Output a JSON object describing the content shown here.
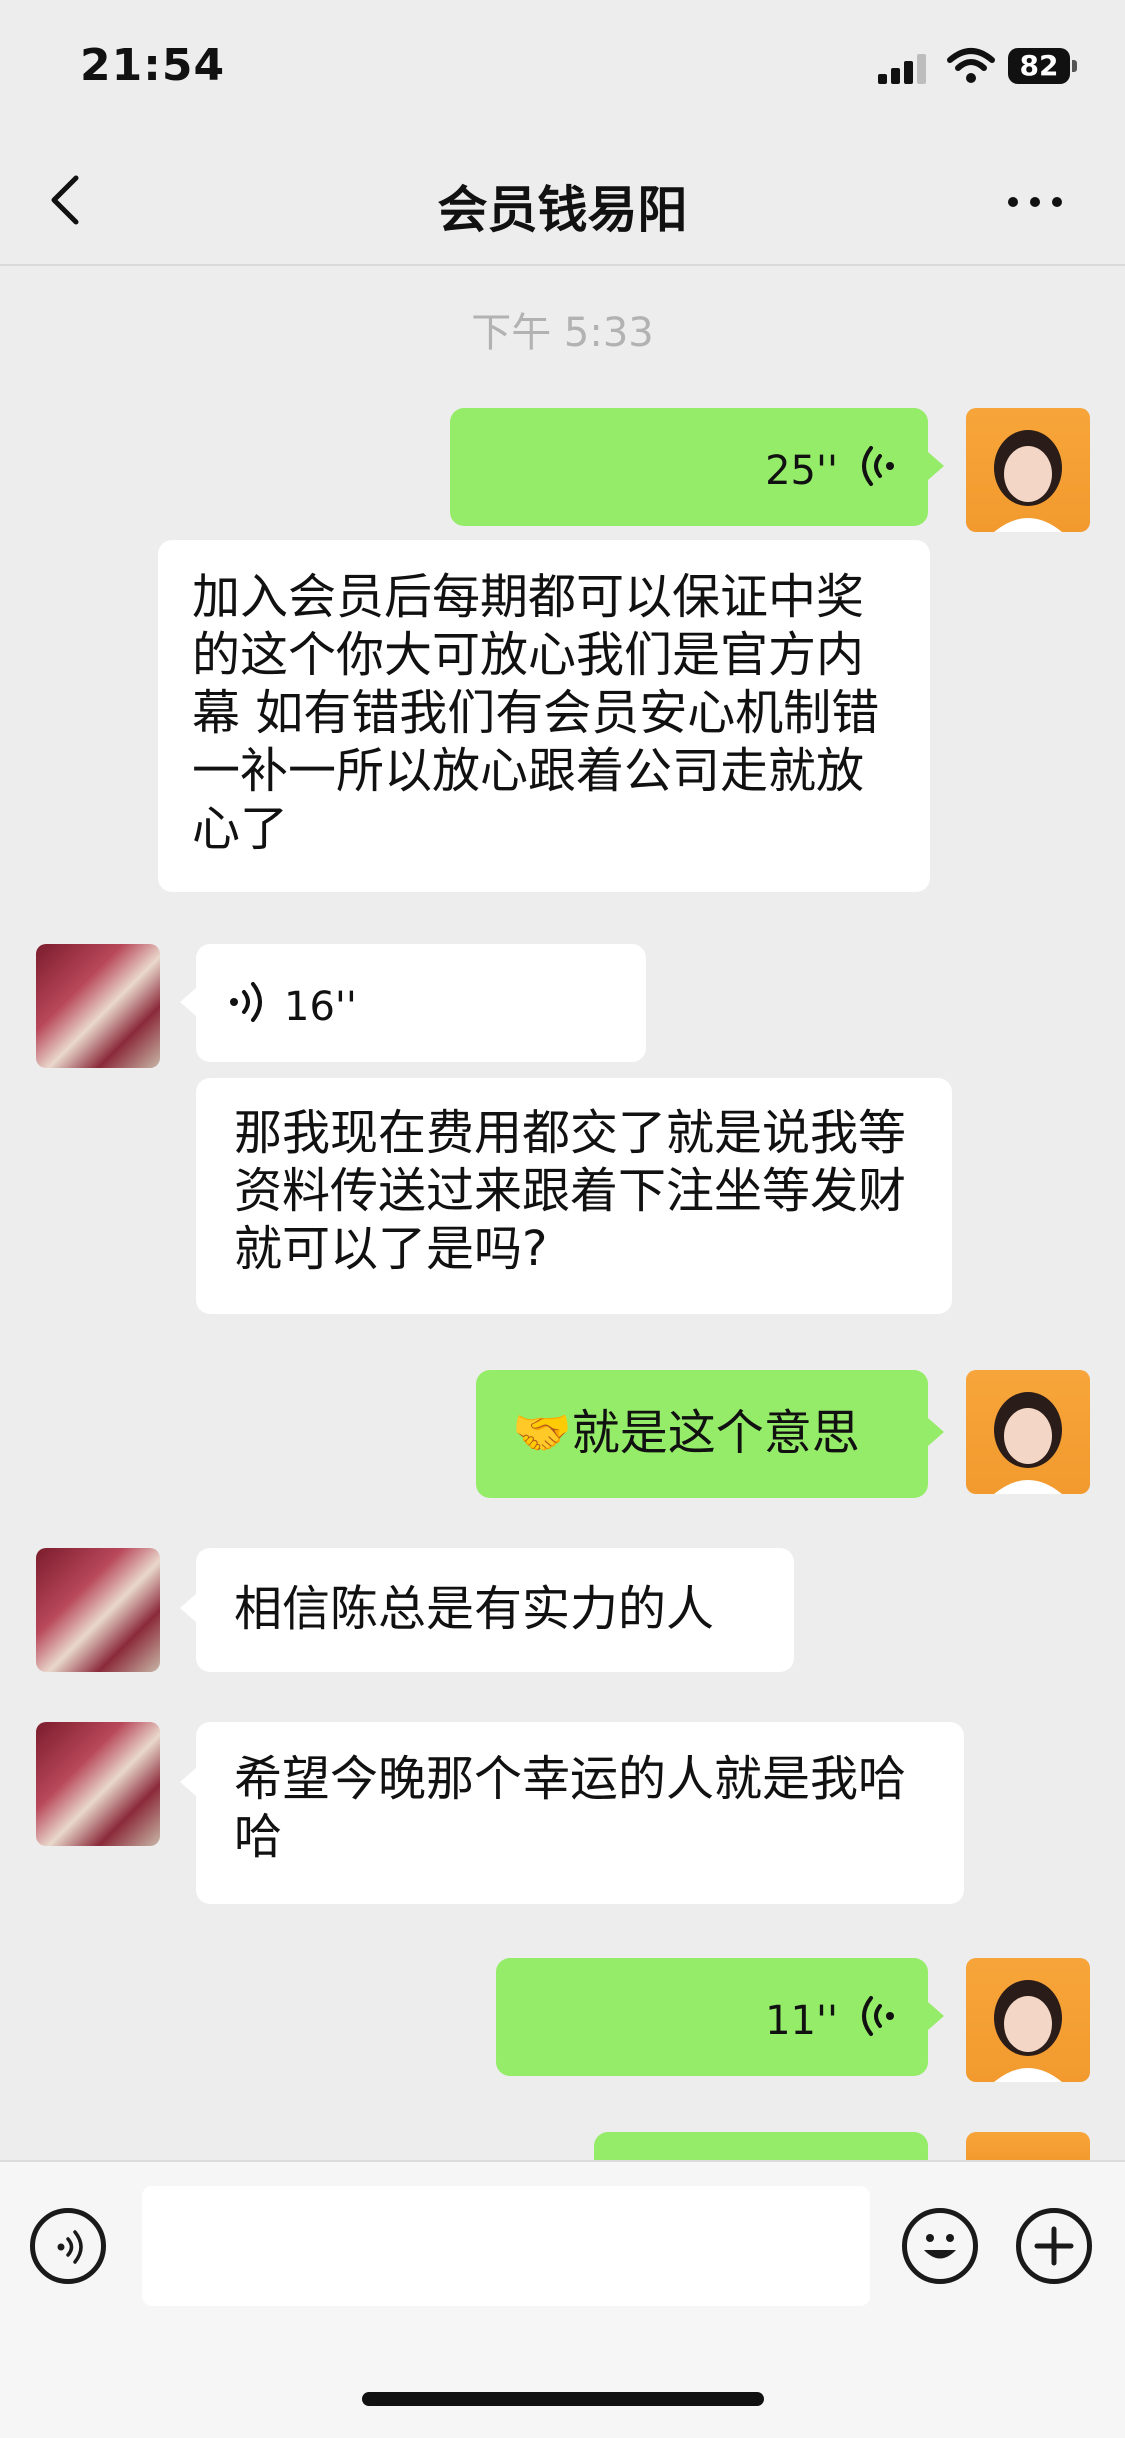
{
  "status_bar": {
    "time": "21:54",
    "battery": "82"
  },
  "header": {
    "title": "会员钱易阳"
  },
  "chat": {
    "timestamp": "下午 5:33",
    "messages": [
      {
        "side": "right",
        "type": "voice",
        "duration": "25''"
      },
      {
        "side": "right",
        "type": "text",
        "text": "加入会员后每期都可以保证中奖的这个你大可放心我们是官方内幕 如有错我们有会员安心机制错一补一所以放心跟着公司走就放心了"
      },
      {
        "side": "left",
        "type": "voice",
        "duration": "16''"
      },
      {
        "side": "left",
        "type": "text",
        "text": "那我现在费用都交了就是说我等资料传送过来跟着下注坐等发财就可以了是吗?"
      },
      {
        "side": "right",
        "type": "text",
        "emoji": "🤝",
        "text": "就是这个意思"
      },
      {
        "side": "left",
        "type": "text",
        "text": "相信陈总是有实力的人"
      },
      {
        "side": "left",
        "type": "text",
        "text": "希望今晚那个幸运的人就是我哈哈"
      },
      {
        "side": "right",
        "type": "voice",
        "duration": "11''"
      }
    ]
  },
  "input_bar": {
    "value": ""
  },
  "colors": {
    "background": "#ededed",
    "sent_bubble": "#95ec69",
    "received_bubble": "#ffffff",
    "timestamp": "#b2b2b2"
  },
  "icons": [
    "signal-icon",
    "wifi-icon",
    "battery-icon",
    "back-arrow-icon",
    "more-dots-icon",
    "voice-wave-icon",
    "voice-input-icon",
    "emoji-icon",
    "plus-icon"
  ]
}
